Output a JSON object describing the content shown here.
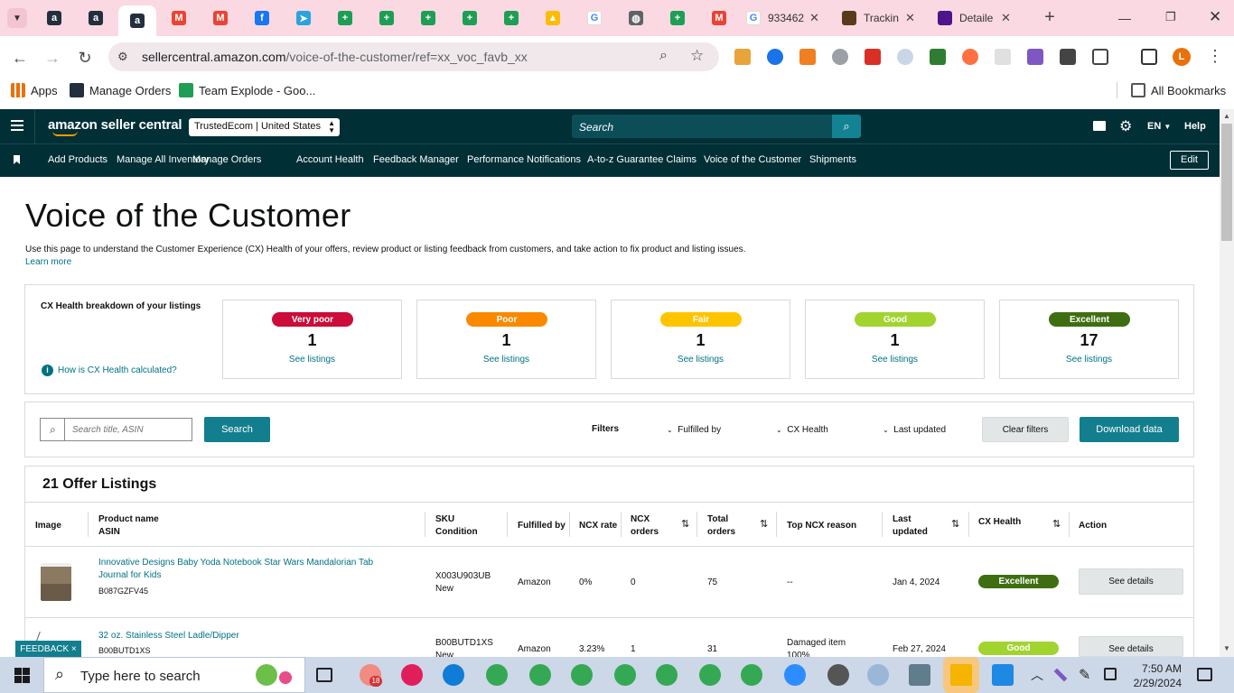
{
  "browser": {
    "tabs": [
      {
        "icon": "amazon-icon",
        "color": "#232f3e",
        "glyph": "a"
      },
      {
        "icon": "amazon-icon",
        "color": "#232f3e",
        "glyph": "a"
      },
      {
        "icon": "amazon-icon",
        "color": "#232f3e",
        "glyph": "a",
        "active": true
      },
      {
        "icon": "gmail-icon",
        "color": "#ea4335",
        "glyph": "M"
      },
      {
        "icon": "gmail-icon",
        "color": "#ea4335",
        "glyph": "M"
      },
      {
        "icon": "facebook-icon",
        "color": "#1877f2",
        "glyph": "f"
      },
      {
        "icon": "telegram-icon",
        "color": "#2aa3df",
        "glyph": "➤"
      },
      {
        "icon": "sheets-icon",
        "color": "#1e9e55",
        "glyph": "+"
      },
      {
        "icon": "sheets-icon",
        "color": "#1e9e55",
        "glyph": "+"
      },
      {
        "icon": "sheets-icon",
        "color": "#1e9e55",
        "glyph": "+"
      },
      {
        "icon": "sheets-icon",
        "color": "#1e9e55",
        "glyph": "+"
      },
      {
        "icon": "sheets-icon",
        "color": "#1e9e55",
        "glyph": "+"
      },
      {
        "icon": "drive-icon",
        "color": "#fbbc04",
        "glyph": "▲"
      },
      {
        "icon": "google-icon",
        "color": "#ffffff",
        "glyph": "G"
      },
      {
        "icon": "globe-icon",
        "color": "#5f6368",
        "glyph": "◍"
      },
      {
        "icon": "sheets-icon",
        "color": "#1e9e55",
        "glyph": "+"
      },
      {
        "icon": "gmail-icon",
        "color": "#ea4335",
        "glyph": "M"
      }
    ],
    "named_tabs": [
      {
        "title": "933462",
        "icon": "google-icon"
      },
      {
        "title": "Trackin",
        "icon": "ups-icon"
      },
      {
        "title": "Detaile",
        "icon": "fedex-icon"
      }
    ],
    "new_tab_label": "+",
    "url_host": "sellercentral.amazon.com",
    "url_path": "/voice-of-the-customer/ref=xx_voc_favb_xx",
    "bookmarks": {
      "apps": "Apps",
      "manage_orders": "Manage Orders",
      "team_explode": "Team Explode - Goo...",
      "all_bookmarks": "All Bookmarks"
    },
    "profile_initial": "L"
  },
  "seller": {
    "logo": "amazon seller central",
    "store": "TrustedEcom | United States",
    "search_placeholder": "Search",
    "lang": "EN",
    "help": "Help",
    "nav": [
      "Add Products",
      "Manage All Inventory",
      "Manage Orders",
      "Account Health",
      "Feedback Manager",
      "Performance Notifications",
      "A-to-z Guarantee Claims",
      "Voice of the Customer",
      "Shipments"
    ],
    "edit": "Edit"
  },
  "page": {
    "title": "Voice of the Customer",
    "description": "Use this page to understand the Customer Experience (CX) Health of your offers, review product or listing feedback from customers, and take action to fix product and listing issues.",
    "learn_more": "Learn more",
    "breakdown_title": "CX Health breakdown of your listings",
    "how_calc": "How is CX Health calculated?",
    "health": [
      {
        "label": "Very poor",
        "count": "1",
        "link": "See listings",
        "bg": "#cc0c39",
        "fg": "#ffffff"
      },
      {
        "label": "Poor",
        "count": "1",
        "link": "See listings",
        "bg": "#fa8900",
        "fg": "#ffffff"
      },
      {
        "label": "Fair",
        "count": "1",
        "link": "See listings",
        "bg": "#ffc400",
        "fg": "#ffffff"
      },
      {
        "label": "Good",
        "count": "1",
        "link": "See listings",
        "bg": "#a1d42f",
        "fg": "#ffffff"
      },
      {
        "label": "Excellent",
        "count": "17",
        "link": "See listings",
        "bg": "#3f6e12",
        "fg": "#ffffff"
      }
    ],
    "search_placeholder": "Search title, ASIN",
    "search_btn": "Search",
    "filters_label": "Filters",
    "filters": [
      "Fulfilled by",
      "CX Health",
      "Last updated"
    ],
    "clear_filters": "Clear filters",
    "download": "Download data",
    "listing_count": "21 Offer Listings",
    "columns": {
      "image": "Image",
      "product": "Product name",
      "asin": "ASIN",
      "sku": "SKU",
      "condition": "Condition",
      "fulfilled": "Fulfilled by",
      "ncx_rate": "NCX rate",
      "ncx_orders_1": "NCX",
      "ncx_orders_2": "orders",
      "total_1": "Total",
      "total_2": "orders",
      "top_reason": "Top NCX reason",
      "last_1": "Last",
      "last_2": "updated",
      "cx": "CX Health",
      "action": "Action"
    },
    "rows": [
      {
        "name_1": "Innovative Designs Baby Yoda Notebook Star Wars Mandalorian Tab",
        "name_2": "Journal for Kids",
        "asin": "B087GZFV45",
        "sku": "X003U903UB",
        "condition": "New",
        "fulfilled": "Amazon",
        "ncx_rate": "0%",
        "ncx_orders": "0",
        "total": "75",
        "reason_1": "--",
        "reason_2": "",
        "updated": "Jan 4, 2024",
        "cx": "Excellent",
        "cx_bg": "#3f6e12",
        "action": "See details"
      },
      {
        "name_1": "32 oz. Stainless Steel Ladle/Dipper",
        "name_2": "",
        "asin": "B00BUTD1XS",
        "sku": "B00BUTD1XS",
        "condition": "New",
        "fulfilled": "Amazon",
        "ncx_rate": "3.23%",
        "ncx_orders": "1",
        "total": "31",
        "reason_1": "Damaged item",
        "reason_2": "100%",
        "updated": "Feb 27, 2024",
        "cx": "Good",
        "cx_bg": "#a1d42f",
        "action": "See details"
      }
    ],
    "feedback": "FEEDBACK",
    "feedback_x": "×"
  },
  "taskbar": {
    "search_placeholder": "Type here to search",
    "time": "7:50 AM",
    "date": "2/29/2024",
    "badge": "18"
  }
}
